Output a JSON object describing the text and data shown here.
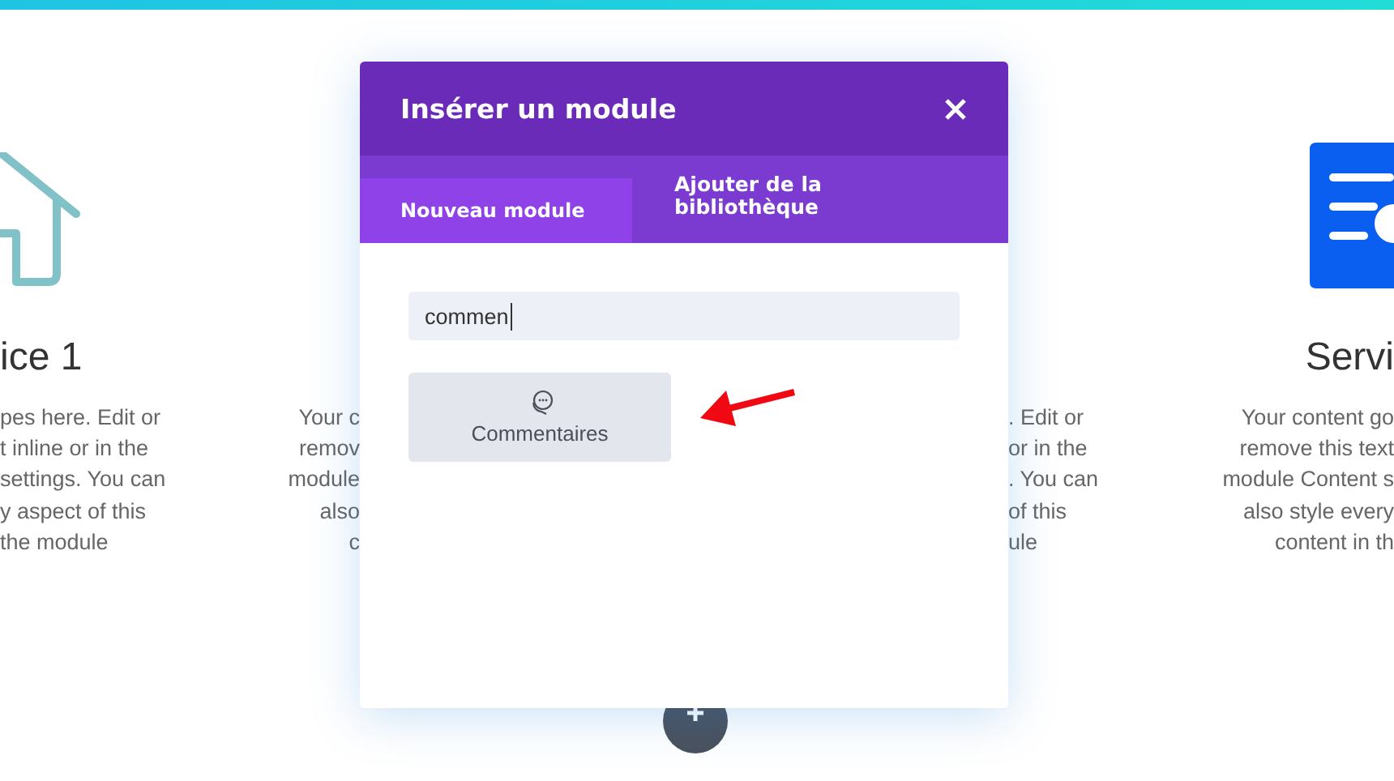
{
  "page_columns": [
    {
      "kind": "house",
      "heading": "ice 1",
      "lines": [
        "pes here. Edit or",
        "t inline or in the",
        "settings. You can",
        "y aspect of this",
        "the module"
      ]
    },
    {
      "kind": "text",
      "lines": [
        "Your c",
        "remov",
        "module",
        "also",
        "c"
      ]
    },
    {
      "kind": "gap"
    },
    {
      "kind": "text",
      "lines": [
        ". Edit or",
        "or in the",
        ". You can",
        "of this",
        "ule"
      ]
    },
    {
      "kind": "document",
      "heading": "Servi",
      "lines": [
        "Your content go",
        "remove this text",
        "module Content s",
        "also style every",
        "content in th"
      ]
    }
  ],
  "modal": {
    "title": "Insérer un module",
    "tabs": [
      {
        "label": "Nouveau module",
        "selected": true
      },
      {
        "label": "Ajouter de la bibliothèque",
        "selected": false
      }
    ],
    "search": {
      "value": "commen"
    },
    "modules": [
      {
        "label": "Commentaires"
      }
    ]
  }
}
